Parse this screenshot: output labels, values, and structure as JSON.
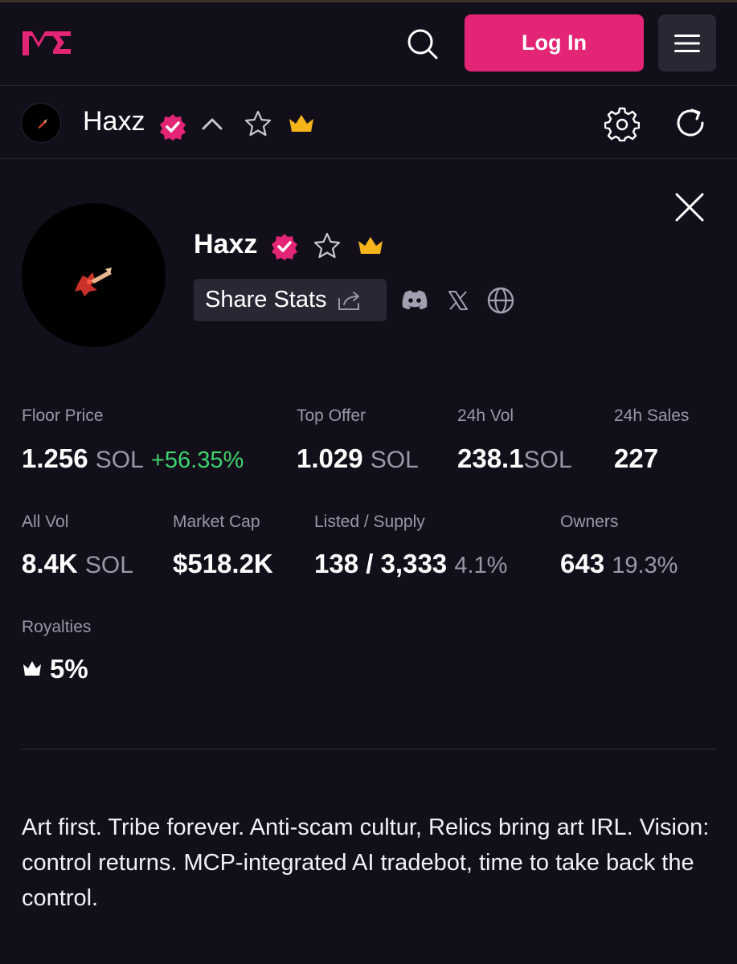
{
  "header": {
    "logo_icon": "magic-eden-logo-icon",
    "search_icon": "search-icon",
    "login_label": "Log In",
    "menu_icon": "hamburger-menu-icon",
    "accent_color": "#e42575"
  },
  "subbar": {
    "collection_name": "Haxz",
    "verified_icon": "verified-badge-icon",
    "collapse_icon": "chevron-up-icon",
    "favorite_icon": "star-icon",
    "crown_icon": "crown-icon",
    "settings_icon": "gear-icon",
    "refresh_icon": "refresh-icon"
  },
  "collection": {
    "name": "Haxz",
    "share_label": "Share Stats",
    "social_icons": [
      "discord-icon",
      "x-icon",
      "globe-icon"
    ]
  },
  "stats": {
    "floor_price": {
      "label": "Floor Price",
      "value": "1.256",
      "unit": "SOL",
      "change": "+56.35%"
    },
    "top_offer": {
      "label": "Top Offer",
      "value": "1.029",
      "unit": "SOL"
    },
    "vol_24h": {
      "label": "24h Vol",
      "value": "238.1",
      "unit": "SOL"
    },
    "sales_24h": {
      "label": "24h Sales",
      "value": "227"
    },
    "all_vol": {
      "label": "All Vol",
      "value": "8.4K",
      "unit": "SOL"
    },
    "market_cap": {
      "label": "Market Cap",
      "value": "$518.2K"
    },
    "listed_supply": {
      "label": "Listed / Supply",
      "value": "138 / 3,333",
      "pct": "4.1%"
    },
    "owners": {
      "label": "Owners",
      "value": "643",
      "pct": "19.3%"
    },
    "royalties": {
      "label": "Royalties",
      "value": "5%"
    }
  },
  "description": "Art first. Tribe forever. Anti-scam cultur, Relics bring art IRL. Vision: control returns. MCP-integrated AI tradebot, time to take back the control."
}
